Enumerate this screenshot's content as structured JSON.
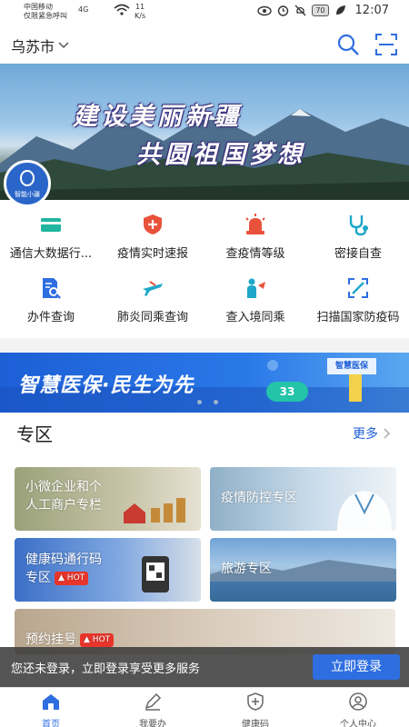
{
  "status_bar": {
    "carrier_line1": "中国移动",
    "carrier_line2": "仅限紧急呼叫",
    "network": "4G",
    "speed_value": "11",
    "speed_unit": "K/s",
    "battery": "70",
    "time": "12:07"
  },
  "header": {
    "city": "乌苏市",
    "search_icon": "search-icon",
    "scan_icon": "scan-icon"
  },
  "banner": {
    "line1": "建设美丽新疆",
    "line2": "共圆祖国梦想",
    "assistant_label": "智能小疆"
  },
  "services": [
    {
      "label": "通信大数据行...",
      "icon": "card-icon",
      "color": "#20b5a0"
    },
    {
      "label": "疫情实时速报",
      "icon": "shield-alert-icon",
      "color": "#e8523b"
    },
    {
      "label": "查疫情等级",
      "icon": "siren-icon",
      "color": "#e8523b"
    },
    {
      "label": "密接自查",
      "icon": "stethoscope-icon",
      "color": "#1ea7c9"
    },
    {
      "label": "办件查询",
      "icon": "document-search-icon",
      "color": "#2e6ee0"
    },
    {
      "label": "肺炎同乘查询",
      "icon": "plane-icon",
      "color": "#1ea7c9"
    },
    {
      "label": "查入境同乘",
      "icon": "passenger-icon",
      "color": "#1ea7c9"
    },
    {
      "label": "扫描国家防疫码",
      "icon": "scan-code-icon",
      "color": "#2e6ee0"
    }
  ],
  "promo": {
    "text": "智慧医保·民生为先",
    "badge": "33",
    "sign": "智慧医保"
  },
  "zone": {
    "title": "专区",
    "more": "更多",
    "cards": [
      {
        "line1": "小微企业和个",
        "line2": "人工商户专栏",
        "hot": ""
      },
      {
        "line1": "疫情防控专区",
        "line2": "",
        "hot": ""
      },
      {
        "line1": "健康码通行码",
        "line2": "专区",
        "hot": "HOT"
      },
      {
        "line1": "旅游专区",
        "line2": "",
        "hot": ""
      },
      {
        "line1": "预约挂号",
        "line2": "",
        "hot": "HOT"
      }
    ]
  },
  "toast": {
    "text": "您还未登录，立即登录享受更多服务",
    "button": "立即登录"
  },
  "tabs": [
    {
      "label": "首页",
      "icon": "home-icon",
      "active": true
    },
    {
      "label": "我要办",
      "icon": "edit-icon",
      "active": false
    },
    {
      "label": "健康码",
      "icon": "health-shield-icon",
      "active": false
    },
    {
      "label": "个人中心",
      "icon": "user-icon",
      "active": false
    }
  ]
}
